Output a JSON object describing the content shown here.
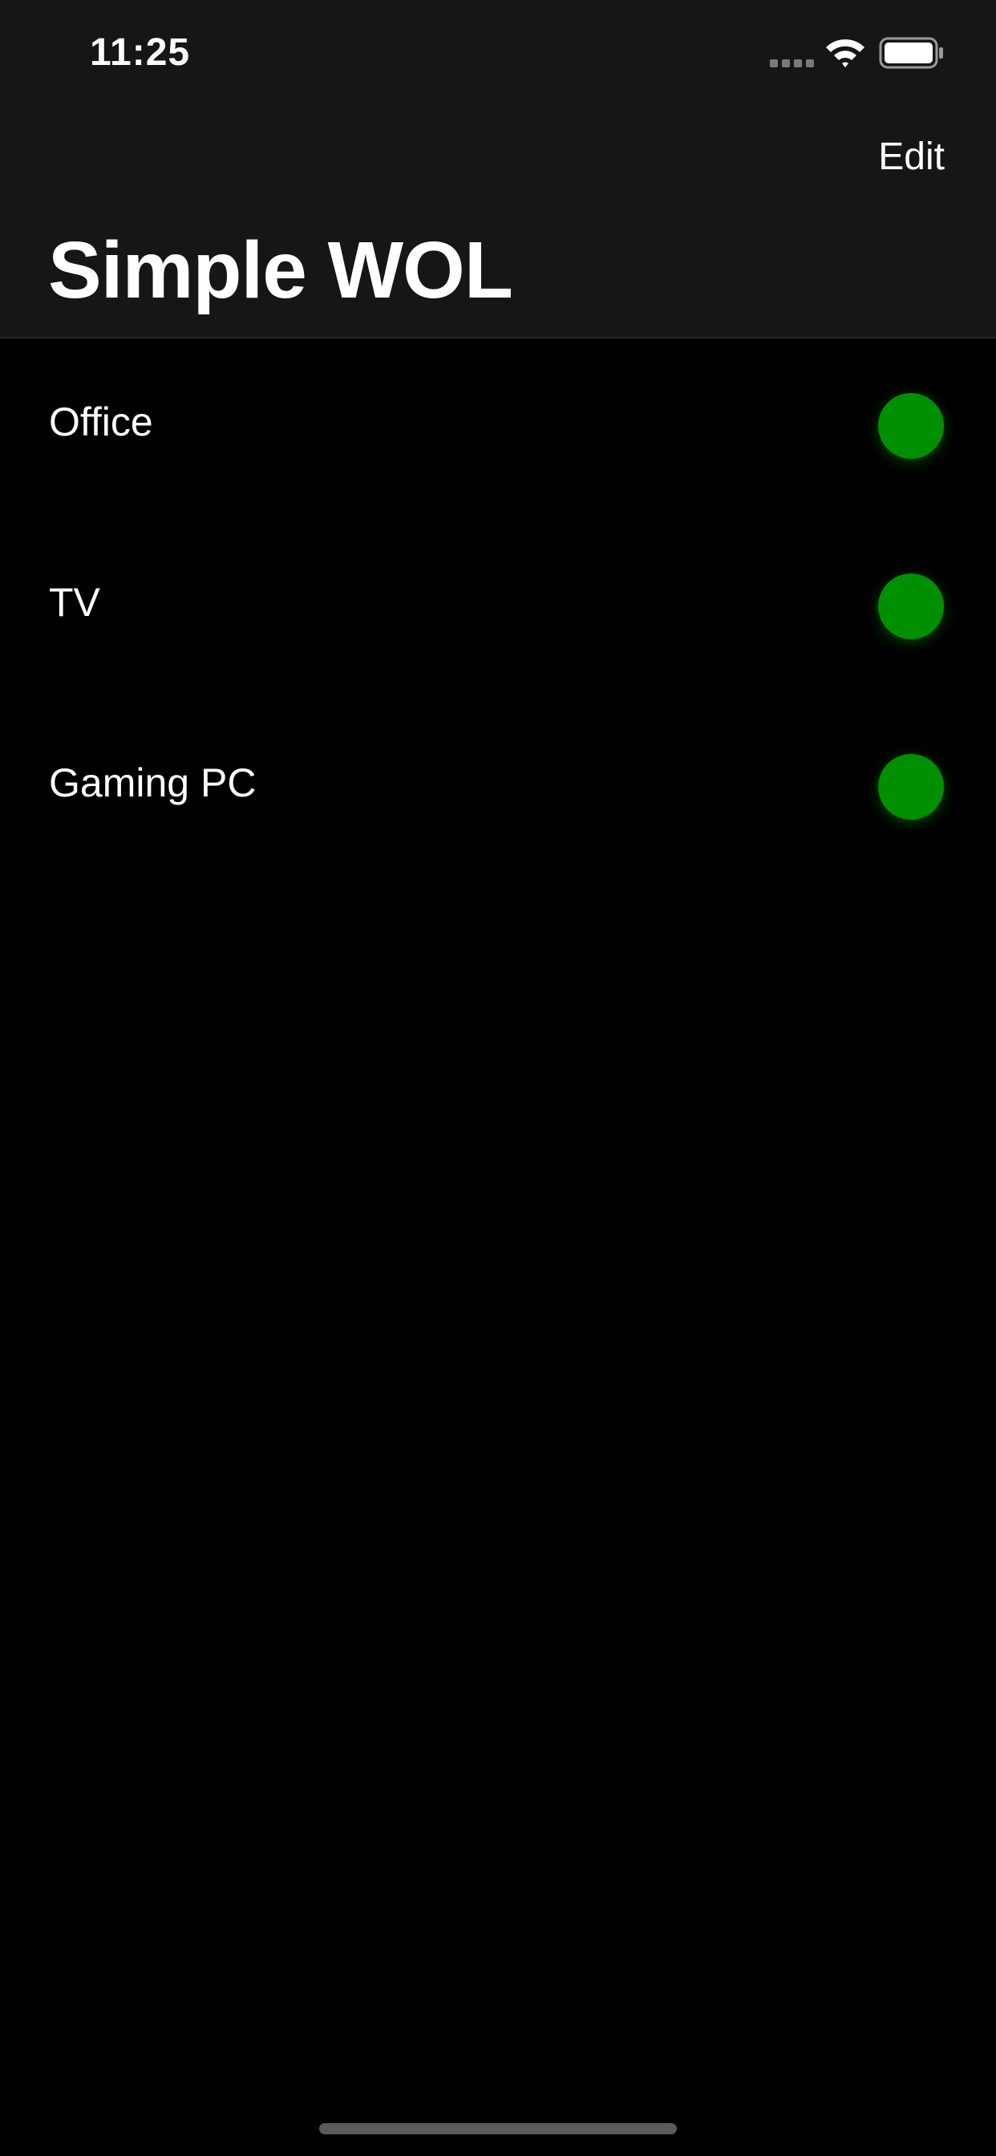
{
  "status_bar": {
    "time": "11:25",
    "icons": [
      "signal-icon",
      "wifi-icon",
      "battery-icon"
    ]
  },
  "nav": {
    "edit_label": "Edit",
    "title": "Simple WOL"
  },
  "devices": [
    {
      "name": "Office",
      "status_color": "#008f00"
    },
    {
      "name": "TV",
      "status_color": "#008f00"
    },
    {
      "name": "Gaming PC",
      "status_color": "#008f00"
    }
  ],
  "colors": {
    "background": "#000000",
    "header_background": "#161616",
    "online": "#008f00"
  }
}
